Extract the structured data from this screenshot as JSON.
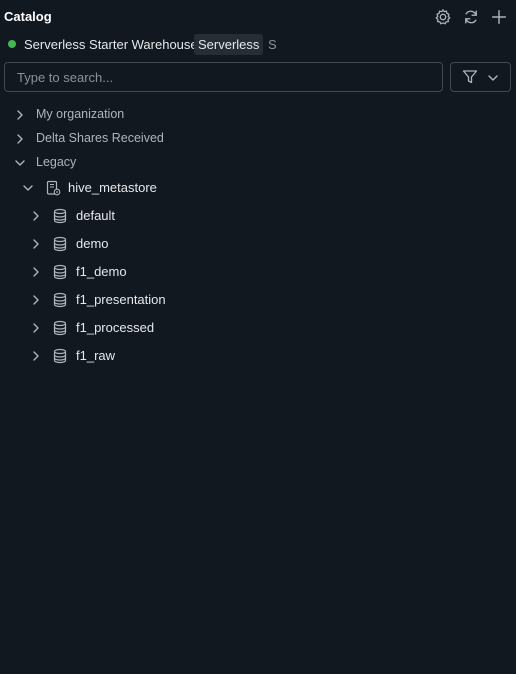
{
  "header": {
    "title": "Catalog",
    "icons": [
      "gear-icon",
      "refresh-icon",
      "plus-icon"
    ]
  },
  "warehouse": {
    "status_color": "#3fb950",
    "name": "Serverless Starter Warehouse",
    "badge": "Serverless",
    "extra": "S"
  },
  "search": {
    "placeholder": "Type to search..."
  },
  "filter": {
    "icon": "filter-icon"
  },
  "tree": {
    "sections": [
      {
        "label": "My organization",
        "expanded": false
      },
      {
        "label": "Delta Shares Received",
        "expanded": false
      },
      {
        "label": "Legacy",
        "expanded": true
      }
    ],
    "metastore": {
      "label": "hive_metastore",
      "expanded": true,
      "icon": "metastore-icon"
    },
    "schemas": [
      {
        "label": "default",
        "icon": "database-icon"
      },
      {
        "label": "demo",
        "icon": "database-icon"
      },
      {
        "label": "f1_demo",
        "icon": "database-icon"
      },
      {
        "label": "f1_presentation",
        "icon": "database-icon"
      },
      {
        "label": "f1_processed",
        "icon": "database-icon"
      },
      {
        "label": "f1_raw",
        "icon": "database-icon"
      }
    ]
  }
}
